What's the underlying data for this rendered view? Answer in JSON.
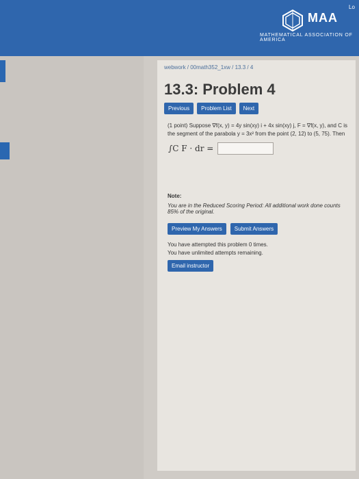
{
  "header": {
    "title": "MAA",
    "subtitle": "MATHEMATICAL ASSOCIATION OF AMERICA",
    "right_text": "Lo"
  },
  "breadcrumb": "webwork / 00math352_1xw / 13.3 / 4",
  "page_title": "13.3: Problem 4",
  "nav_buttons": [
    "Previous",
    "Problem List",
    "Next"
  ],
  "problem": {
    "text": "(1 point) Suppose ∇f(x, y) = 4y sin(xy) i + 4x sin(xy) j, F = ∇f(x, y), and C is the segment of the parabola y = 3x² from the point (2, 12) to (5, 75). Then",
    "integral_label": "∫C F · dr ="
  },
  "note": {
    "label": "Note:",
    "text": "You are in the Reduced Scoring Period: All additional work done counts 85% of the original."
  },
  "actions": [
    "Preview My Answers",
    "Submit Answers"
  ],
  "status": {
    "line1": "You have attempted this problem 0 times.",
    "line2": "You have unlimited attempts remaining."
  },
  "email_button": "Email instructor",
  "colors": {
    "header": "#2f66ad",
    "button": "#2f66ad",
    "page_bg": "#e8e5e0"
  }
}
